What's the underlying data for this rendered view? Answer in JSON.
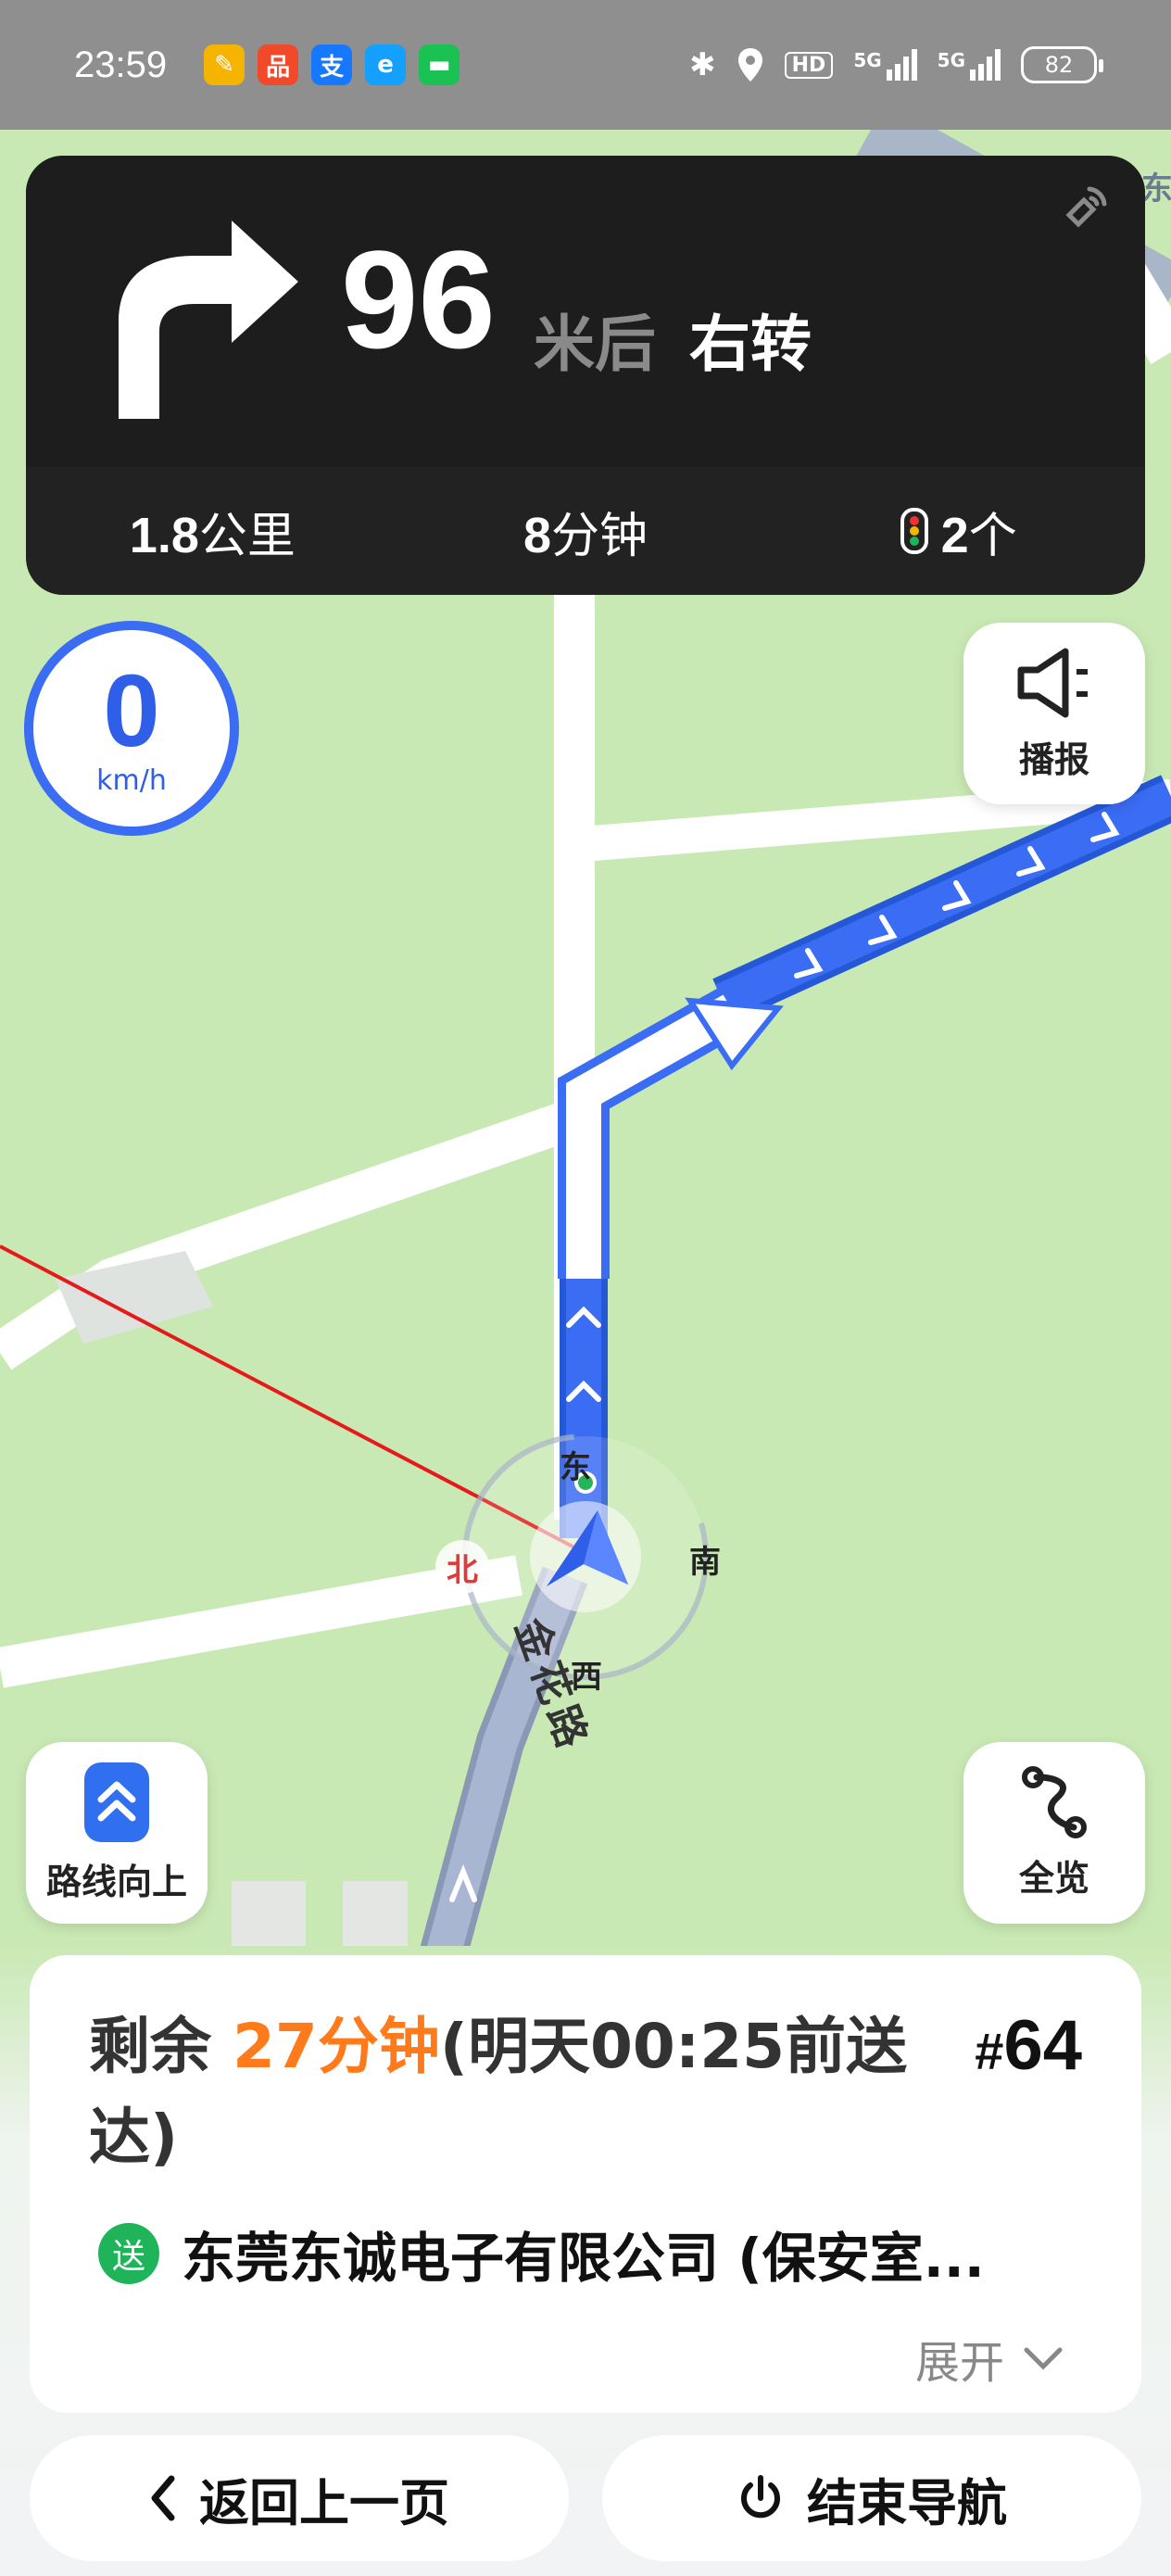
{
  "status": {
    "time": "23:59",
    "hd": "HD",
    "sig1": "5G",
    "sig2": "5G",
    "battery": "82",
    "colors": {
      "bar": "#8f8f8f"
    }
  },
  "nav": {
    "distance": "96",
    "unit": "米后",
    "action": "右转",
    "remaining_distance_num": "1.8",
    "remaining_distance_unit": "公里",
    "remaining_time_num": "8",
    "remaining_time_unit": "分钟",
    "traffic_lights_num": "2",
    "traffic_lights_unit": "个"
  },
  "speed": {
    "value": "0",
    "unit": "km/h"
  },
  "buttons": {
    "broadcast": "播报",
    "route_up": "路线向上",
    "overview": "全览",
    "back": "返回上一页",
    "end": "结束导航"
  },
  "map": {
    "compass": {
      "east": "东",
      "west": "西",
      "south": "南",
      "north": "北"
    },
    "road_name": "金花路",
    "label_top_right": "东"
  },
  "delivery": {
    "eta_prefix": "剩余 ",
    "eta_time": "27分钟",
    "eta_suffix": "(明天00:25前送达)",
    "order_hash": "#",
    "order_no": "64",
    "badge": "送",
    "destination": "东莞东诚电子有限公司 (保安室...",
    "expand": "展开"
  },
  "colors": {
    "route": "#3a6cf4",
    "accent_orange": "#ff7a1a",
    "map_green": "#c9e9b4"
  }
}
